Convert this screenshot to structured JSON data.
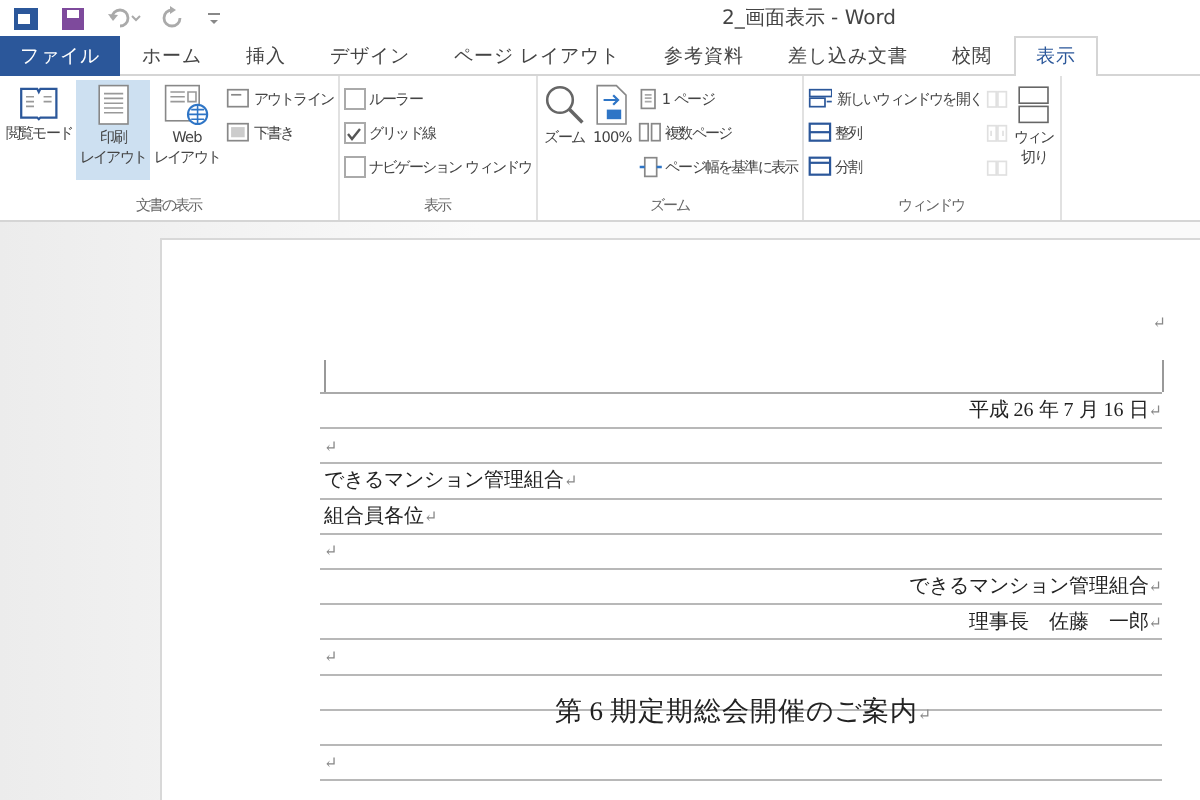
{
  "window": {
    "title": "2_画面表示 - Word"
  },
  "tabs": [
    {
      "label": "ファイル",
      "kind": "file",
      "selected": false
    },
    {
      "label": "ホーム",
      "kind": "tab",
      "selected": false
    },
    {
      "label": "挿入",
      "kind": "tab",
      "selected": false
    },
    {
      "label": "デザイン",
      "kind": "tab",
      "selected": false
    },
    {
      "label": "ページ レイアウト",
      "kind": "tab",
      "selected": false
    },
    {
      "label": "参考資料",
      "kind": "tab",
      "selected": false
    },
    {
      "label": "差し込み文書",
      "kind": "tab",
      "selected": false
    },
    {
      "label": "校閲",
      "kind": "tab",
      "selected": false
    },
    {
      "label": "表示",
      "kind": "tab",
      "selected": true
    }
  ],
  "ribbon": {
    "groups": [
      {
        "label": "文書の表示",
        "items": [
          {
            "kind": "large",
            "lines": [
              "閲覧モード"
            ],
            "selected": false
          },
          {
            "kind": "large",
            "lines": [
              "印刷",
              "レイアウト"
            ],
            "selected": true
          },
          {
            "kind": "large",
            "lines": [
              "Web",
              "レイアウト"
            ],
            "selected": false
          },
          {
            "kind": "small",
            "label": "アウトライン",
            "selected": false
          },
          {
            "kind": "small",
            "label": "下書き",
            "selected": false
          }
        ]
      },
      {
        "label": "表示",
        "items": [
          {
            "kind": "check",
            "label": "ルーラー",
            "checked": false
          },
          {
            "kind": "check",
            "label": "グリッド線",
            "checked": true
          },
          {
            "kind": "check",
            "label": "ナビゲーション ウィンドウ",
            "checked": false
          }
        ]
      },
      {
        "label": "ズーム",
        "items": [
          {
            "kind": "large",
            "lines": [
              "ズーム"
            ],
            "selected": false
          },
          {
            "kind": "large",
            "lines": [
              "100%"
            ],
            "selected": false
          },
          {
            "kind": "small",
            "label": "1 ページ",
            "selected": false
          },
          {
            "kind": "small",
            "label": "複数ページ",
            "selected": false
          },
          {
            "kind": "small",
            "label": "ページ幅を基準に表示",
            "selected": false
          }
        ]
      },
      {
        "label": "ウィンドウ",
        "items": [
          {
            "kind": "small",
            "label": "新しいウィンドウを開く",
            "selected": false
          },
          {
            "kind": "small",
            "label": "整列",
            "selected": false
          },
          {
            "kind": "small",
            "label": "分割",
            "selected": false
          },
          {
            "kind": "icon",
            "disabled": true
          },
          {
            "kind": "icon",
            "disabled": true
          },
          {
            "kind": "icon",
            "disabled": true
          },
          {
            "kind": "large",
            "lines": [
              "ウィン",
              "切り"
            ],
            "selected": false
          }
        ]
      }
    ]
  },
  "document": {
    "header_mark": "↵",
    "paragraphs": [
      {
        "kind": "right",
        "text": "平成 26 年 7 月 16 日",
        "mark": "↵"
      },
      {
        "kind": "left",
        "mark": "↵"
      },
      {
        "kind": "left",
        "text": "できるマンション管理組合",
        "mark": "↵"
      },
      {
        "kind": "left",
        "text": "組合員各位",
        "mark": "↵"
      },
      {
        "kind": "left",
        "mark": "↵"
      },
      {
        "kind": "right",
        "text": "できるマンション管理組合",
        "mark": "↵"
      },
      {
        "kind": "right",
        "text": "理事長　佐藤　一郎",
        "mark": "↵"
      },
      {
        "kind": "left",
        "mark": "↵"
      },
      {
        "kind": "title",
        "text": "第 6 期定期総会開催のご案内",
        "mark": "↵"
      },
      {
        "kind": "left",
        "mark": "↵"
      }
    ]
  }
}
